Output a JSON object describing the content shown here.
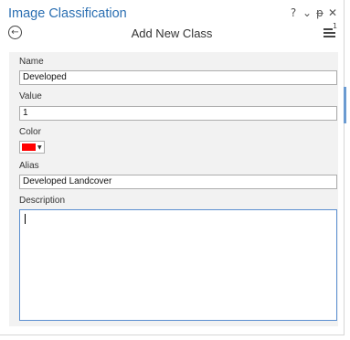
{
  "pane": {
    "title": "Image Classification",
    "help_label": "?",
    "dropdown_label": "⌄",
    "pin_label": "ᵽ",
    "close_label": "✕"
  },
  "header": {
    "back_label": "←",
    "subtitle": "Add New Class",
    "menu_superscript": "1"
  },
  "form": {
    "name_label": "Name",
    "name_value": "Developed",
    "value_label": "Value",
    "value_value": "1",
    "color_label": "Color",
    "color_value": "#ff0000",
    "alias_label": "Alias",
    "alias_value": "Developed Landcover",
    "description_label": "Description",
    "description_value": ""
  },
  "colors": {
    "title": "#2b6fb2",
    "focus_border": "#5b8fd0",
    "swatch": "#ff0000"
  }
}
